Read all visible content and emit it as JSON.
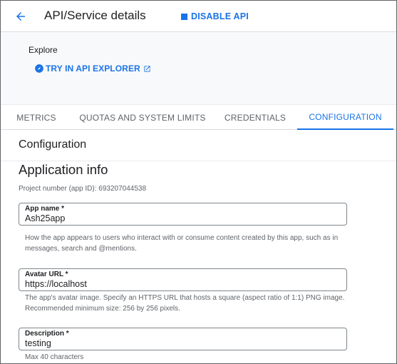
{
  "header": {
    "title": "API/Service details",
    "disable_label": "DISABLE API"
  },
  "explore": {
    "title": "Explore",
    "link_label": "TRY IN API EXPLORER"
  },
  "tabs": [
    {
      "label": "METRICS",
      "active": false
    },
    {
      "label": "QUOTAS AND SYSTEM LIMITS",
      "active": false
    },
    {
      "label": "CREDENTIALS",
      "active": false
    },
    {
      "label": "CONFIGURATION",
      "active": true
    }
  ],
  "configuration": {
    "section_title": "Configuration",
    "app_info_title": "Application info",
    "project_number": "Project number (app ID): 693207044538",
    "fields": {
      "app_name": {
        "label": "App name *",
        "value": "Ash25app",
        "hint": "How the app appears to users who interact with or consume content created by this app, such as in messages, search and @mentions."
      },
      "avatar_url": {
        "label": "Avatar URL *",
        "value": "https://localhost",
        "hint": "The app's avatar image. Specify an HTTPS URL that hosts a square (aspect ratio of 1:1) PNG image. Recommended minimum size: 256 by 256 pixels."
      },
      "description": {
        "label": "Description *",
        "value": "testing",
        "hint": "Max 40 characters"
      }
    }
  },
  "colors": {
    "accent": "#1a73e8",
    "text_primary": "#202124",
    "text_secondary": "#5f6368",
    "panel_bg": "#f8f9fa"
  },
  "icons": {
    "back": "arrow-left-icon",
    "disable": "stop-square-icon",
    "explorer": "compass-icon",
    "external": "external-link-icon"
  }
}
